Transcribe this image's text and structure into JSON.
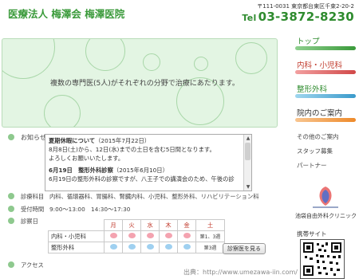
{
  "header": {
    "logo": "医療法人 梅澤会 梅澤医院",
    "address": "〒111-0031 東京都台東区千束2-20-2",
    "tel_prefix": "Tel",
    "tel": "03-3872-8230"
  },
  "hero": {
    "text": "複数の専門医(5人)がそれぞれの分野で治療にあたります。"
  },
  "news": {
    "label": "お知らせ",
    "items": [
      {
        "title": "夏期休暇について",
        "date": "（2015年7月22日）"
      },
      {
        "text": "8月8日(土)から、12日(水)までの土日を含む5日間となります。"
      },
      {
        "text": "よろしくお願いいたします。"
      },
      {
        "title": "6月19日　整形外科診察",
        "date": "（2015年6月10日）"
      },
      {
        "text": "6月19日の整形外科の診察ですが、八王子での講演会のため、午後の診"
      }
    ]
  },
  "departments": {
    "label": "診療科目",
    "value": "内科、循環器科、胃腸科、腎臓内科、小児科、整形外科、リハビリテーション科"
  },
  "hours": {
    "label": "受付時間",
    "value": "9:00〜13:00　14:30〜17:30"
  },
  "schedule": {
    "label": "診察日",
    "days": [
      "月",
      "火",
      "水",
      "木",
      "金",
      "土"
    ],
    "rows": [
      {
        "dept": "内科・小児科",
        "marks": [
          "pink",
          "pink",
          "pink",
          "pink",
          "pink"
        ],
        "sat": "第1、3週"
      },
      {
        "dept": "整形外科",
        "marks": [
          "blue",
          "blue",
          "blue",
          "blue",
          "blue"
        ],
        "sat": "第3週"
      }
    ],
    "button": "診察医を見る"
  },
  "access": {
    "label": "アクセス"
  },
  "nav": {
    "items": [
      {
        "label": "トップ",
        "color": "#2e8b2e"
      },
      {
        "label": "内科・小児科",
        "color": "#c0392b"
      },
      {
        "label": "整形外科",
        "color": "#2e8b2e"
      },
      {
        "label": "院内のご案内",
        "color": "#333333"
      }
    ],
    "small_items": [
      {
        "label": "その他のご案内"
      },
      {
        "label": "スタッフ募集"
      },
      {
        "label": "パートナー"
      }
    ],
    "clinic": "池袋自由外科クリニック",
    "mobile": "携帯サイト"
  },
  "watermark": "出典：http://www.umezawa-iin.com/",
  "colors": {
    "accent_green": "#2e8b2e",
    "hero_bg": "#e3f5e3",
    "pink_dot": "#f4a3b0",
    "blue_dot": "#9fd0f0"
  }
}
